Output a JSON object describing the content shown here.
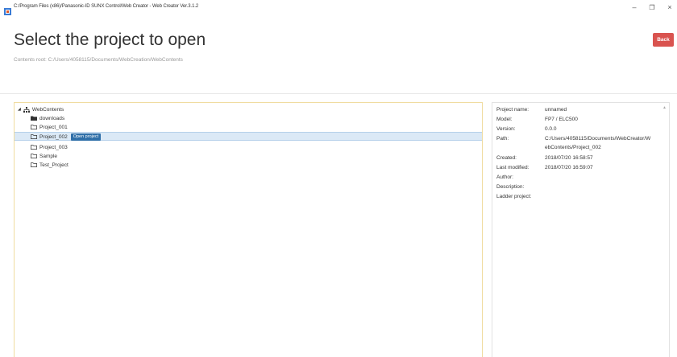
{
  "window": {
    "title": "C:/Program Files (x86)/Panasonic-ID SUNX Control/Web Creator - Web Creator Ver.3.1.2",
    "minimize_glyph": "–",
    "maximize_glyph": "❐",
    "close_glyph": "×"
  },
  "header": {
    "title": "Select the project to open",
    "contents_root": "Contents root: C:/Users/4058115/Documents/WebCreation/WebContents",
    "back_label": "Back"
  },
  "colors": {
    "back_button": "#d9534f",
    "selection": "#dbe9f6",
    "tooltip": "#2f6fa8",
    "tree_border": "#f0dca0"
  },
  "tree": {
    "root": {
      "label": "WebContents",
      "icon": "sitemap-icon"
    },
    "items": [
      {
        "label": "downloads",
        "icon": "folder-filled-icon"
      },
      {
        "label": "Project_001",
        "icon": "folder-outline-icon"
      },
      {
        "label": "Project_002",
        "icon": "folder-outline-icon",
        "selected": true,
        "tooltip": "Open project"
      },
      {
        "label": "Project_003",
        "icon": "folder-outline-icon"
      },
      {
        "label": "Sample",
        "icon": "folder-outline-icon"
      },
      {
        "label": "Test_Project",
        "icon": "folder-outline-icon"
      }
    ]
  },
  "info": {
    "project_name": {
      "label": "Project name:",
      "value": "unnamed"
    },
    "model": {
      "label": "Model:",
      "value": "FP7 / ELC500"
    },
    "version": {
      "label": "Version:",
      "value": "0.0.0"
    },
    "path": {
      "label": "Path:",
      "value_line1": "C:/Users/4058115/Documents/WebCreator/W",
      "value_line2": "ebContents/Project_002"
    },
    "created": {
      "label": "Created:",
      "value": "2018/07/20 16:58:57"
    },
    "last_modified": {
      "label": "Last modified:",
      "value": "2018/07/20 16:59:07"
    },
    "author": {
      "label": "Author:",
      "value": ""
    },
    "description": {
      "label": "Description:",
      "value": ""
    },
    "ladder_project": {
      "label": "Ladder project:",
      "value": ""
    }
  }
}
